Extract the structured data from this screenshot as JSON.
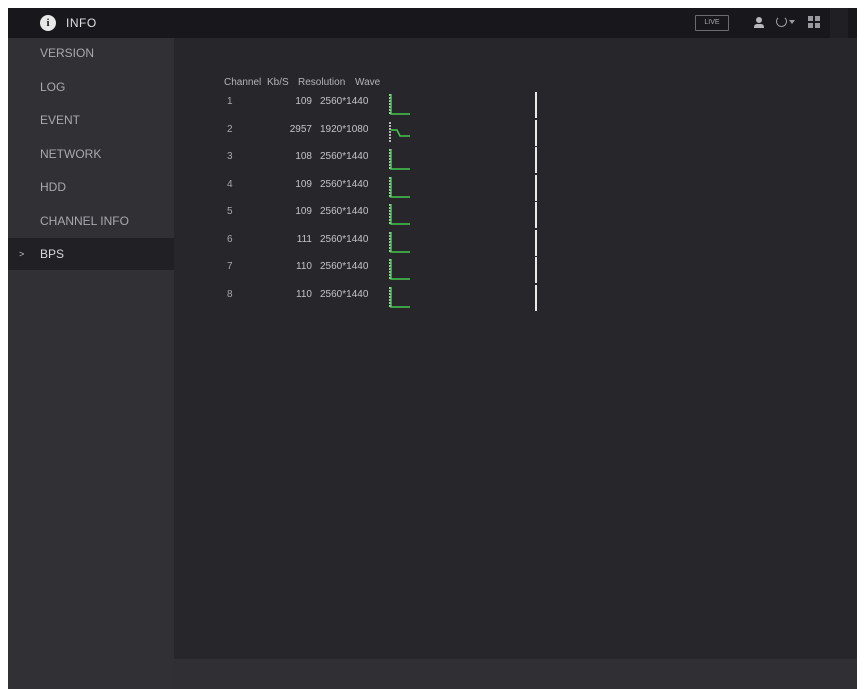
{
  "header": {
    "title": "INFO",
    "live_label": "LIVE"
  },
  "colors": {
    "wave": "#47c94e",
    "marker": "#e8e8e8",
    "active_bg": "#202025"
  },
  "sidebar": {
    "items": [
      {
        "label": "VERSION",
        "active": false
      },
      {
        "label": "LOG",
        "active": false
      },
      {
        "label": "EVENT",
        "active": false
      },
      {
        "label": "NETWORK",
        "active": false
      },
      {
        "label": "HDD",
        "active": false
      },
      {
        "label": "CHANNEL INFO",
        "active": false
      },
      {
        "label": "BPS",
        "active": true,
        "marker": ">"
      }
    ]
  },
  "table": {
    "headers": {
      "channel": "Channel",
      "kbs": "Kb/S",
      "resolution": "Resolution",
      "wave": "Wave"
    },
    "rows": [
      {
        "channel": "1",
        "kbs": "109",
        "resolution": "2560*1440",
        "wave": "low"
      },
      {
        "channel": "2",
        "kbs": "2957",
        "resolution": "1920*1080",
        "wave": "drop"
      },
      {
        "channel": "3",
        "kbs": "108",
        "resolution": "2560*1440",
        "wave": "low"
      },
      {
        "channel": "4",
        "kbs": "109",
        "resolution": "2560*1440",
        "wave": "low"
      },
      {
        "channel": "5",
        "kbs": "109",
        "resolution": "2560*1440",
        "wave": "low"
      },
      {
        "channel": "6",
        "kbs": "111",
        "resolution": "2560*1440",
        "wave": "low"
      },
      {
        "channel": "7",
        "kbs": "110",
        "resolution": "2560*1440",
        "wave": "low"
      },
      {
        "channel": "8",
        "kbs": "110",
        "resolution": "2560*1440",
        "wave": "low"
      }
    ]
  }
}
